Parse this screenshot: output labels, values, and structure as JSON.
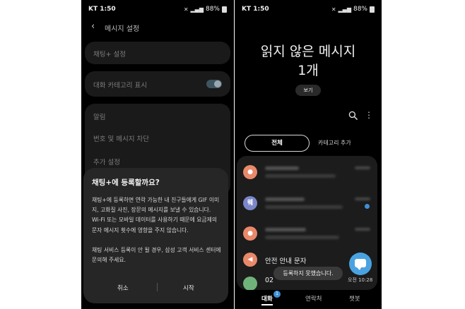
{
  "left_screen": {
    "status": {
      "carrier": "KT 1:50",
      "battery": "88%"
    },
    "header": {
      "title": "메시지 설정"
    },
    "settings": {
      "chat_plus": "채팅+ 설정",
      "category": "대화 카테고리 표시",
      "category_toggle": true,
      "notifications": "알림",
      "block": "번호 및 메시지 차단",
      "more": "추가 설정"
    },
    "dialog": {
      "title": "채팅+에 등록할까요?",
      "para1": "채팅+에 등록하면 연락 가능한 내 친구들에게 GIF 이미지, 고화질 사진, 장문의 메시지를 보낼 수 있습니다. Wi-Fi 또는 모바일 데이터를 사용하기 때문에 요금제의 문자 메시지 횟수에 영향을 주지 않습니다.",
      "para2": "채팅 서비스 등록이 안 될 경우, 삼성 고객 서비스 센터에 문의해 주세요.",
      "cancel": "취소",
      "start": "시작"
    }
  },
  "right_screen": {
    "status": {
      "carrier": "KT 1:50",
      "battery": "88%"
    },
    "headline": "읽지 않은 메시지 1개",
    "view_button": "보기",
    "tabs": {
      "all": "전체",
      "add_category": "카테고리 추가"
    },
    "conversations": [
      {
        "avatar": "",
        "name": "",
        "avatar_color": "#e8896a",
        "blurred": true,
        "unread": false
      },
      {
        "avatar": "웨",
        "name": "",
        "avatar_color": "#7b86c9",
        "blurred": true,
        "unread": true
      },
      {
        "avatar": "",
        "name": "",
        "avatar_color": "#e8896a",
        "blurred": true,
        "unread": false
      },
      {
        "avatar": "",
        "name": "안전 안내 문자",
        "avatar_color": "#e8896a",
        "blurred": false,
        "unread": false
      },
      {
        "avatar": "",
        "name": "02",
        "avatar_color": "#6fb37a",
        "blurred": false,
        "unread": false
      }
    ],
    "toast": "등록하지 못했습니다.",
    "timestamp": "오전 10:28",
    "bottom_nav": {
      "chats": "대화",
      "chats_badge": "1",
      "contacts": "연락처",
      "chatbot": "챗봇"
    }
  }
}
